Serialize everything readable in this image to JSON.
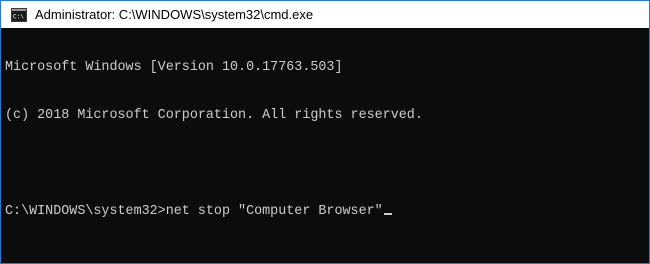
{
  "window": {
    "title": "Administrator: C:\\WINDOWS\\system32\\cmd.exe",
    "icon": "cmd-icon"
  },
  "console": {
    "lines": [
      "Microsoft Windows [Version 10.0.17763.503]",
      "(c) 2018 Microsoft Corporation. All rights reserved.",
      "",
      "C:\\WINDOWS\\system32>net stop \"Computer Browser\""
    ]
  },
  "colors": {
    "background": "#0c0c0c",
    "text": "#cccccc",
    "border": "#2b79c9"
  }
}
